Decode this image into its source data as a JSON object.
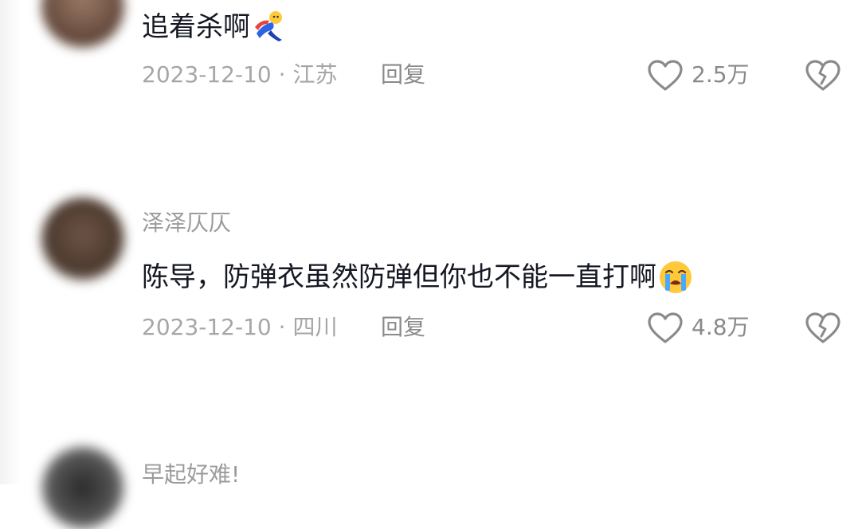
{
  "comments": [
    {
      "username": "",
      "text": "追着杀啊",
      "emoji": "running-person-emoji",
      "date": "2023-12-10",
      "location": "江苏",
      "reply_label": "回复",
      "likes": "2.5万",
      "avatar_color": "#7a5a4a"
    },
    {
      "username": "泽泽仄仄",
      "text": "陈导，防弹衣虽然防弹但你也不能一直打啊",
      "emoji": "loudly-crying-emoji",
      "date": "2023-12-10",
      "location": "四川",
      "reply_label": "回复",
      "likes": "4.8万",
      "avatar_color": "#5a4636"
    },
    {
      "username": "早起好难!",
      "avatar_color": "#3f3f3f"
    }
  ],
  "icons": {
    "like": "heart-outline-icon",
    "dislike": "broken-heart-icon"
  },
  "colors": {
    "text": "#161823",
    "meta": "#a6a6a6",
    "icon": "#8a8a8a"
  }
}
